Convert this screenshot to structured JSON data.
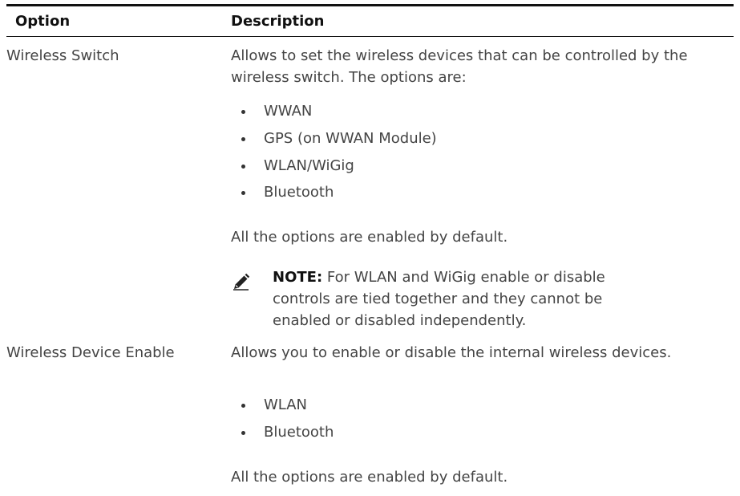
{
  "table": {
    "headers": {
      "option": "Option",
      "description": "Description"
    },
    "rows": [
      {
        "option": "Wireless Switch",
        "intro": "Allows to set the wireless devices that can be controlled by the wireless switch. The options are:",
        "bullets": [
          "WWAN",
          "GPS (on WWAN Module)",
          "WLAN/WiGig",
          "Bluetooth"
        ],
        "default_text": "All the options are enabled by default.",
        "note": {
          "icon": "pencil-note-icon",
          "label": "NOTE:",
          "text": "For WLAN and WiGig enable or disable controls are tied together and they cannot be enabled or disabled independently."
        }
      },
      {
        "option": "Wireless Device Enable",
        "intro": "Allows you to enable or disable the internal wireless devices.",
        "bullets": [
          "WLAN",
          "Bluetooth"
        ],
        "default_text": "All the options are enabled by default."
      }
    ]
  }
}
